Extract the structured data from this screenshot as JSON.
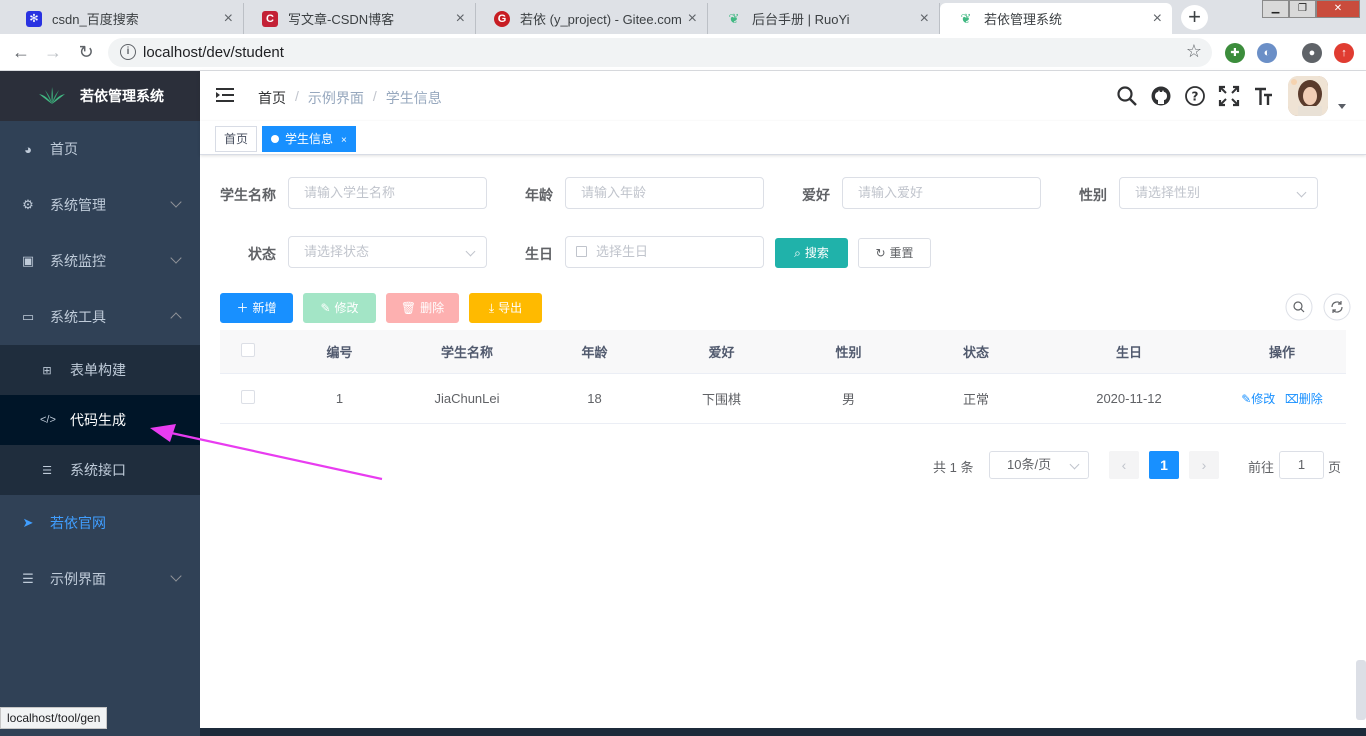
{
  "browser": {
    "tabs": [
      {
        "title": "csdn_百度搜索",
        "favicon": "baidu-paw-icon",
        "color": "#2932e1"
      },
      {
        "title": "写文章-CSDN博客",
        "favicon": "csdn-icon",
        "color": "#c32136"
      },
      {
        "title": "若依 (y_project) - Gitee.com",
        "favicon": "gitee-icon",
        "color": "#c71d23"
      },
      {
        "title": "后台手册 | RuoYi",
        "favicon": "ruoyi-leaf-icon",
        "color": "#42b983"
      },
      {
        "title": "若依管理系统",
        "favicon": "ruoyi-leaf-icon",
        "color": "#42b983"
      }
    ],
    "url": "localhost/dev/student",
    "status_url": "localhost/tool/gen"
  },
  "sidebar": {
    "logo_text": "若依管理系统",
    "items": [
      {
        "label": "首页",
        "icon": "dashboard-icon"
      },
      {
        "label": "系统管理",
        "icon": "gear-icon"
      },
      {
        "label": "系统监控",
        "icon": "monitor-icon"
      },
      {
        "label": "系统工具",
        "icon": "toolbox-icon"
      },
      {
        "label": "若依官网",
        "icon": "paper-plane-icon"
      },
      {
        "label": "示例界面",
        "icon": "list-icon"
      }
    ],
    "tool_sub": [
      {
        "label": "表单构建",
        "icon": "grid-icon"
      },
      {
        "label": "代码生成",
        "icon": "code-icon"
      },
      {
        "label": "系统接口",
        "icon": "sliders-icon"
      }
    ]
  },
  "navbar": {
    "breadcrumb": [
      "首页",
      "示例界面",
      "学生信息"
    ]
  },
  "tags": {
    "home": "首页",
    "active": "学生信息",
    "close": "×"
  },
  "search": {
    "name_label": "学生名称",
    "name_placeholder": "请输入学生名称",
    "age_label": "年龄",
    "age_placeholder": "请输入年龄",
    "hobby_label": "爱好",
    "hobby_placeholder": "请输入爱好",
    "sex_label": "性别",
    "sex_placeholder": "请选择性别",
    "status_label": "状态",
    "status_placeholder": "请选择状态",
    "birthday_label": "生日",
    "birthday_placeholder": "选择生日",
    "search_btn": "搜索",
    "reset_btn": "重置"
  },
  "actions": {
    "add": "新增",
    "edit": "修改",
    "delete": "删除",
    "export": "导出"
  },
  "table": {
    "columns": [
      "编号",
      "学生名称",
      "年龄",
      "爱好",
      "性别",
      "状态",
      "生日",
      "操作"
    ],
    "rows": [
      {
        "id": "1",
        "name": "JiaChunLei",
        "age": "18",
        "hobby": "下围棋",
        "sex": "男",
        "status": "正常",
        "birthday": "2020-11-12",
        "edit": "修改",
        "delete": "删除"
      }
    ]
  },
  "pagination": {
    "total": "共 1 条",
    "page_size": "10条/页",
    "current": "1",
    "goto_prefix": "前往",
    "goto_value": "1",
    "goto_suffix": "页"
  },
  "colors": {
    "primary": "#1890ff",
    "sidebar_bg": "#304156",
    "arrow": "#e83cf0"
  }
}
